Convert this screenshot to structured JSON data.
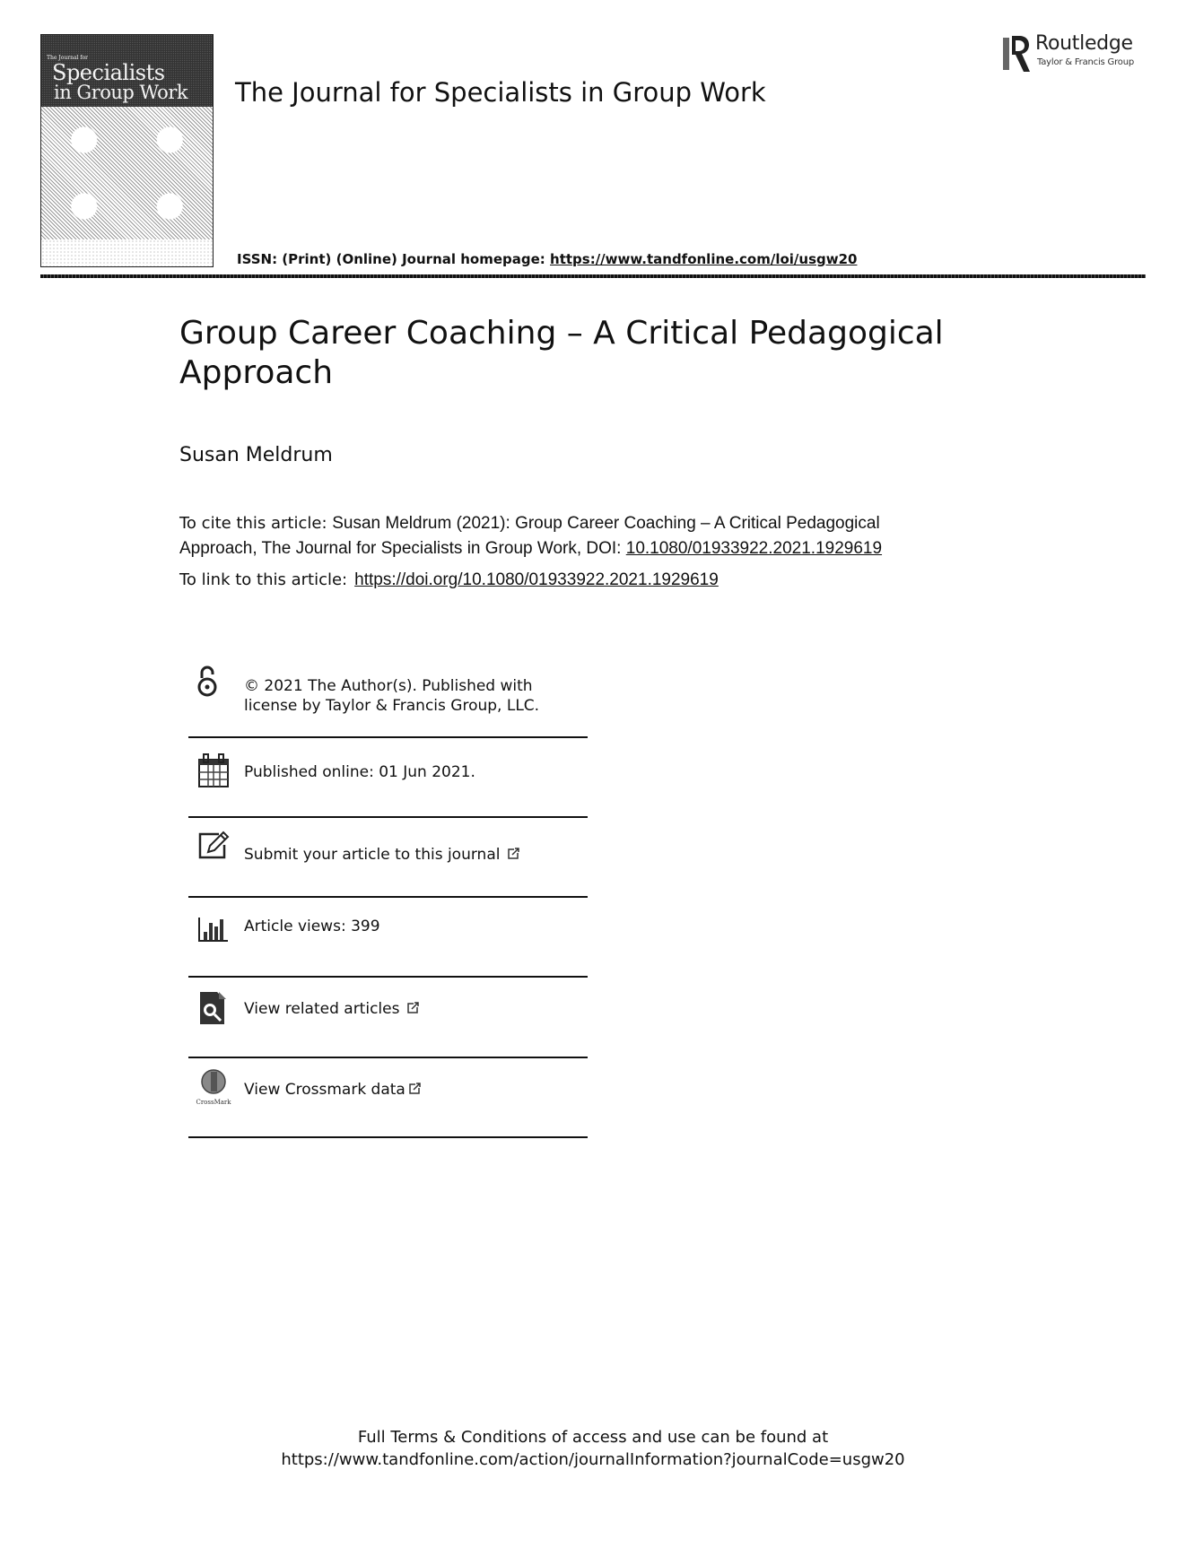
{
  "cover": {
    "small_text": "The Journal for",
    "title_line1": "Specialists",
    "title_line2": "in Group Work"
  },
  "header": {
    "journal_title": "The Journal for Specialists in Group Work",
    "issn_label": "ISSN: (Print) (Online) Journal homepage: ",
    "homepage_url": "https://www.tandfonline.com/loi/usgw20"
  },
  "publisher": {
    "name": "Routledge",
    "subtitle": "Taylor & Francis Group",
    "vertical_text": "ROUTLEDGE"
  },
  "article": {
    "title_line1": "Group Career Coaching – A Critical Pedagogical",
    "title_line2": "Approach",
    "author": "Susan Meldrum",
    "cite_label": "To cite this article: ",
    "cite_text_line1": "Susan Meldrum (2021): Group Career Coaching – A Critical Pedagogical",
    "cite_text_line2": "Approach, The Journal for Specialists in Group Work, DOI: ",
    "doi": "10.1080/01933922.2021.1929619",
    "link_label": "To link to this article:",
    "link_url": "https://doi.org/10.1080/01933922.2021.1929619"
  },
  "info": {
    "license_line1": "© 2021 The Author(s). Published with",
    "license_line2": "license by Taylor & Francis Group, LLC.",
    "published": "Published online: 01 Jun 2021.",
    "submit": "Submit your article to this journal",
    "views": "Article views: 399",
    "related": "View related articles",
    "crossmark": "View Crossmark data",
    "crossmark_caption": "CrossMark"
  },
  "footer": {
    "line1": "Full Terms & Conditions of access and use can be found at",
    "line2": "https://www.tandfonline.com/action/journalInformation?journalCode=usgw20"
  }
}
